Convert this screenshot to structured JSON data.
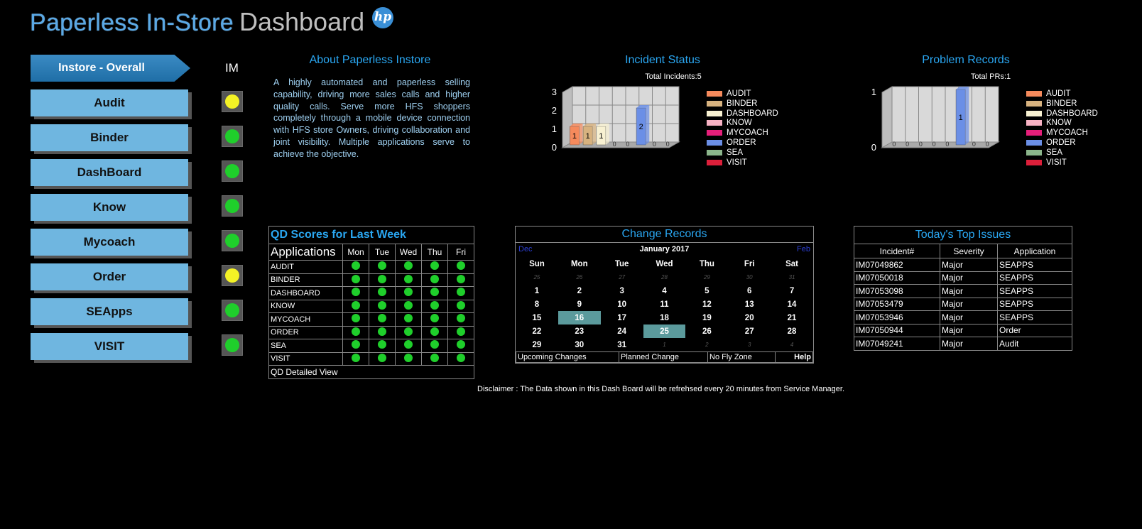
{
  "header": {
    "title_part1": "Paperless In-Store",
    "title_part2": "Dashboard",
    "logo_text": "hp"
  },
  "nav": {
    "overall": "Instore - Overall",
    "im_label": "IM",
    "items": [
      {
        "label": "Audit",
        "status": "yellow"
      },
      {
        "label": "Binder",
        "status": "green"
      },
      {
        "label": "DashBoard",
        "status": "green"
      },
      {
        "label": "Know",
        "status": "green"
      },
      {
        "label": "Mycoach",
        "status": "green"
      },
      {
        "label": "Order",
        "status": "yellow"
      },
      {
        "label": "SEApps",
        "status": "green"
      },
      {
        "label": "VISIT",
        "status": "green"
      }
    ]
  },
  "about": {
    "title": "About Paperless Instore",
    "text": "A highly automated and paperless selling capability, driving more sales calls and higher quality calls. Serve more HFS shoppers completely through a mobile device connection with HFS store Owners, driving collaboration and joint visibility. Multiple applications serve to achieve the objective."
  },
  "incident": {
    "title": "Incident Status",
    "total": "Total Incidents:5"
  },
  "problem": {
    "title": "Problem Records",
    "total": "Total PRs:1"
  },
  "legend": [
    {
      "label": "AUDIT",
      "color": "#f58a5c"
    },
    {
      "label": "BINDER",
      "color": "#d7b27f"
    },
    {
      "label": "DASHBOARD",
      "color": "#f8f1d2"
    },
    {
      "label": "KNOW",
      "color": "#f7b2c4"
    },
    {
      "label": "MYCOACH",
      "color": "#e61f7a"
    },
    {
      "label": "ORDER",
      "color": "#6b8fe6"
    },
    {
      "label": "SEA",
      "color": "#8bb58b"
    },
    {
      "label": "VISIT",
      "color": "#dc1f3a"
    }
  ],
  "chart_data": [
    {
      "type": "bar",
      "title": "Incident Status",
      "subtitle": "Total Incidents:5",
      "categories": [
        "AUDIT",
        "BINDER",
        "DASHBOARD",
        "KNOW",
        "MYCOACH",
        "ORDER",
        "SEA",
        "VISIT"
      ],
      "values": [
        1,
        1,
        1,
        0,
        0,
        2,
        0,
        0
      ],
      "yticks": [
        "0",
        "1",
        "2",
        "3"
      ],
      "ylim": [
        0,
        3
      ],
      "legend": "right"
    },
    {
      "type": "bar",
      "title": "Problem Records",
      "subtitle": "Total PRs:1",
      "categories": [
        "AUDIT",
        "BINDER",
        "DASHBOARD",
        "KNOW",
        "MYCOACH",
        "ORDER",
        "SEA",
        "VISIT"
      ],
      "values": [
        0,
        0,
        0,
        0,
        0,
        1,
        0,
        0
      ],
      "yticks": [
        "0",
        "1"
      ],
      "ylim": [
        0,
        1
      ],
      "legend": "right"
    }
  ],
  "qd": {
    "title": "QD Scores for Last Week",
    "apps_header": "Applications",
    "days": [
      "Mon",
      "Tue",
      "Wed",
      "Thu",
      "Fri"
    ],
    "rows": [
      "AUDIT",
      "BINDER",
      "DASHBOARD",
      "KNOW",
      "MYCOACH",
      "ORDER",
      "SEA",
      "VISIT"
    ],
    "footer": "QD Detailed View"
  },
  "calendar": {
    "title": "Change Records",
    "prev": "Dec",
    "next": "Feb",
    "month": "January 2017",
    "day_names": [
      "Sun",
      "Mon",
      "Tue",
      "Wed",
      "Thu",
      "Fri",
      "Sat"
    ],
    "weeks": [
      [
        "25",
        "26",
        "27",
        "28",
        "29",
        "30",
        "31"
      ],
      [
        "1",
        "2",
        "3",
        "4",
        "5",
        "6",
        "7"
      ],
      [
        "8",
        "9",
        "10",
        "11",
        "12",
        "13",
        "14"
      ],
      [
        "15",
        "16",
        "17",
        "18",
        "19",
        "20",
        "21"
      ],
      [
        "22",
        "23",
        "24",
        "25",
        "26",
        "27",
        "28"
      ],
      [
        "29",
        "30",
        "31",
        "1",
        "2",
        "3",
        "4"
      ]
    ],
    "footer": [
      "Upcoming Changes",
      "Planned Change",
      "No Fly Zone",
      "Help"
    ]
  },
  "top_issues": {
    "title": "Today's Top Issues",
    "columns": [
      "Incident#",
      "Severity",
      "Application"
    ],
    "rows": [
      [
        "IM07049862",
        "Major",
        "SEAPPS"
      ],
      [
        "IM07050018",
        "Major",
        "SEAPPS"
      ],
      [
        "IM07053098",
        "Major",
        "SEAPPS"
      ],
      [
        "IM07053479",
        "Major",
        "SEAPPS"
      ],
      [
        "IM07053946",
        "Major",
        "SEAPPS"
      ],
      [
        "IM07050944",
        "Major",
        "Order"
      ],
      [
        "IM07049241",
        "Major",
        "Audit"
      ]
    ]
  },
  "disclaimer": "Disclaimer : The Data shown in this Dash Board will be refrehsed every 20 minutes from Service Manager."
}
